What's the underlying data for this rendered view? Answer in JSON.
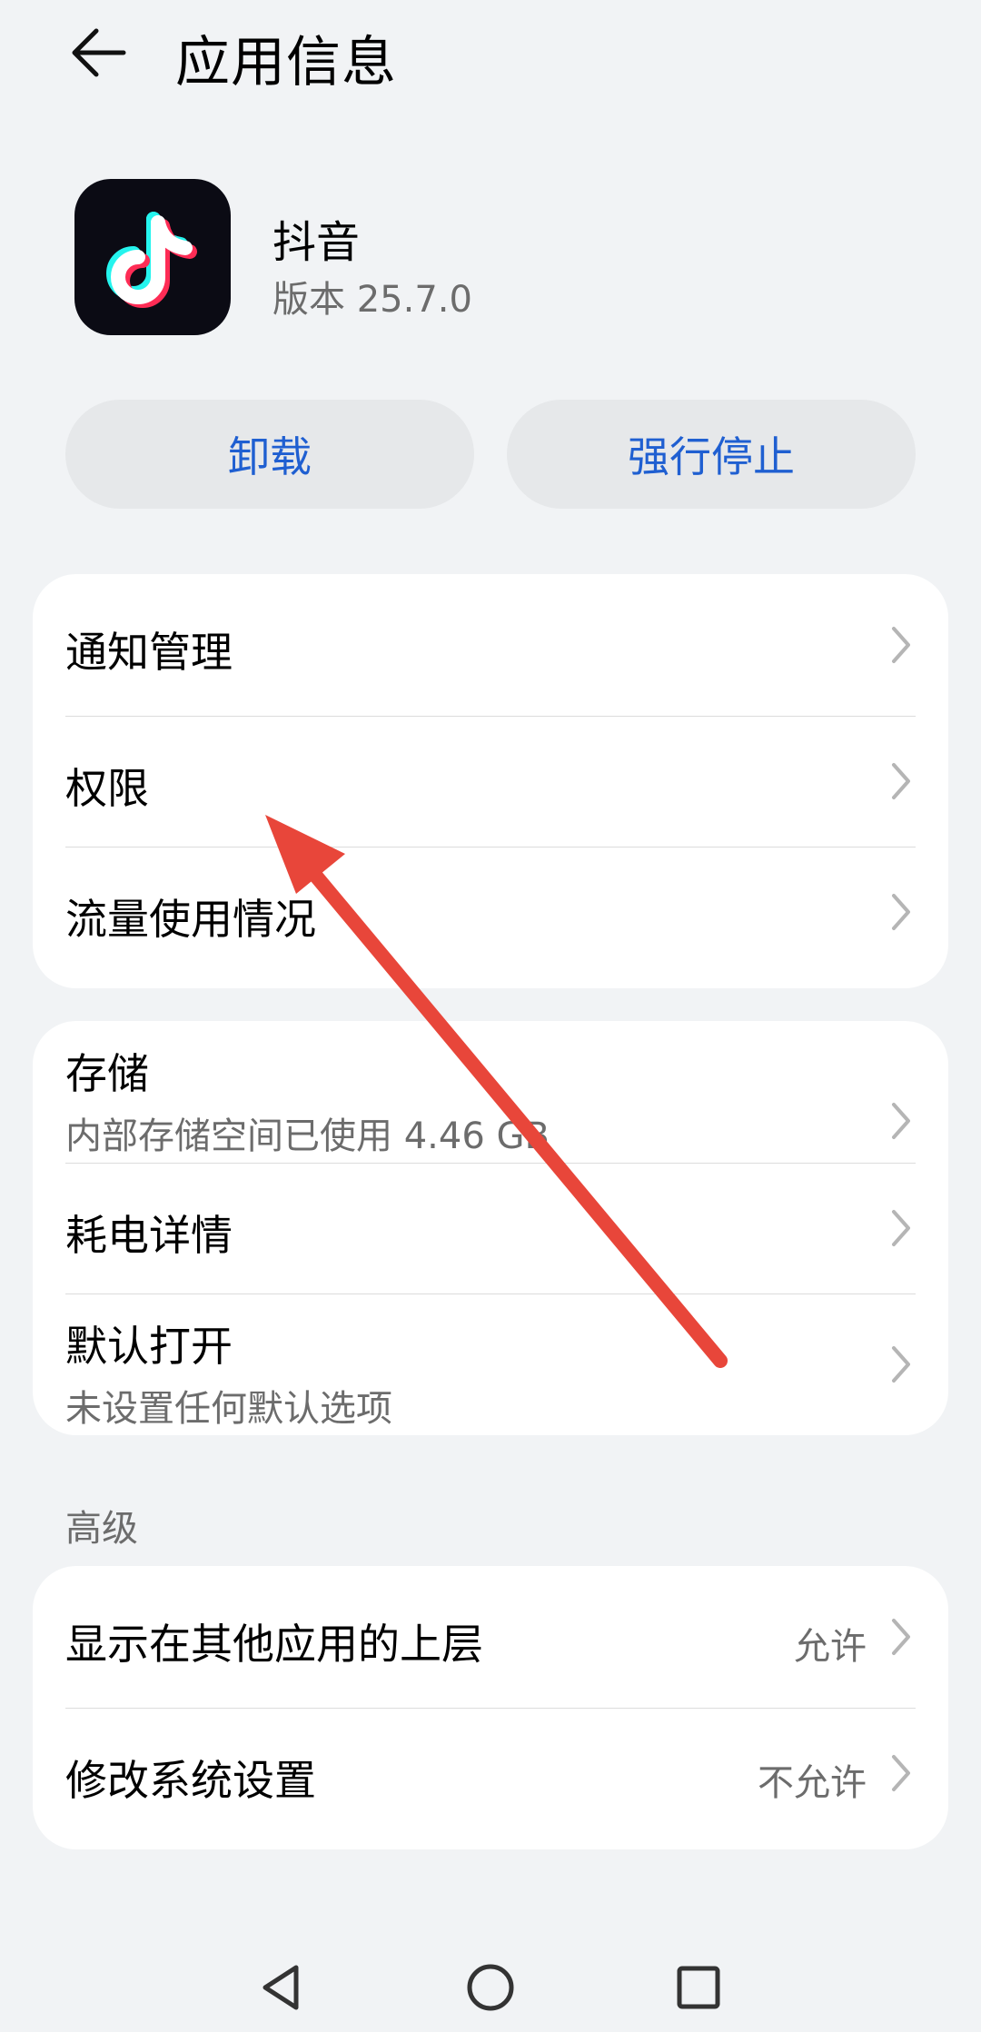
{
  "header": {
    "title": "应用信息",
    "back_icon": "arrow-left-icon"
  },
  "app": {
    "name": "抖音",
    "version": "版本 25.7.0",
    "icon": "tiktok-logo-icon"
  },
  "actions": {
    "uninstall_label": "卸载",
    "force_stop_label": "强行停止",
    "accent_color": "#1f5fd1"
  },
  "card1": {
    "notification": "通知管理",
    "permissions": "权限",
    "data_usage": "流量使用情况"
  },
  "card2": {
    "storage": {
      "label": "存储",
      "sub": "内部存储空间已使用 4.46 GB"
    },
    "battery": "耗电详情",
    "open_by_default": {
      "label": "默认打开",
      "sub": "未设置任何默认选项"
    }
  },
  "advanced": {
    "heading": "高级",
    "overlay": {
      "label": "显示在其他应用的上层",
      "value": "允许"
    },
    "modify_system": {
      "label": "修改系统设置",
      "value": "不允许"
    }
  },
  "nav": {
    "back": "triangle-back-icon",
    "home": "circle-home-icon",
    "recents": "square-recents-icon"
  },
  "annotation": {
    "arrow_color": "#e8463a"
  }
}
